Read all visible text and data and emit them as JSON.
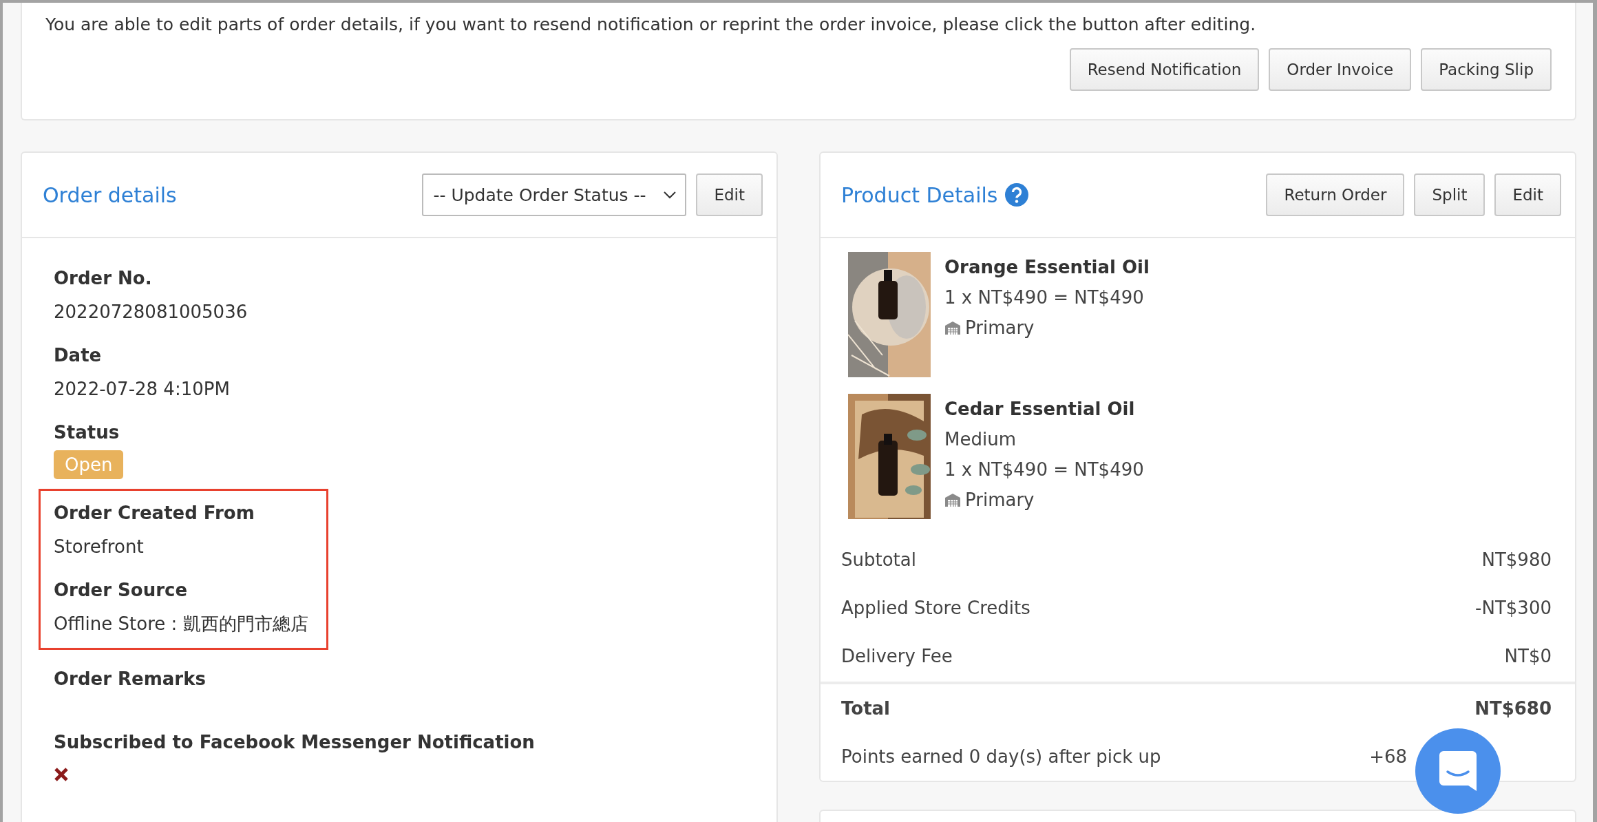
{
  "notice": {
    "text": "You are able to edit parts of order details, if you want to resend notification or reprint the order invoice, please click the button after editing.",
    "buttons": [
      "Resend Notification",
      "Order Invoice",
      "Packing Slip"
    ]
  },
  "order_details": {
    "title": "Order details",
    "status_select": {
      "placeholder": "-- Update Order Status --"
    },
    "edit_button": "Edit",
    "fields": [
      {
        "kind": "text",
        "label": "Order No.",
        "value": "20220728081005036",
        "highlighted": false
      },
      {
        "kind": "text",
        "label": "Date",
        "value": "2022-07-28 4:10PM",
        "highlighted": false
      },
      {
        "kind": "badge",
        "label": "Status",
        "value": "Open",
        "highlighted": false
      },
      {
        "kind": "text",
        "label": "Order Created From",
        "value": "Storefront",
        "highlighted": true
      },
      {
        "kind": "text",
        "label": "Order Source",
        "value": "Offline Store : 凱西的門市總店",
        "highlighted": true
      },
      {
        "kind": "empty",
        "label": "Order Remarks",
        "highlighted": false
      },
      {
        "kind": "check",
        "label": "Subscribed to Facebook Messenger Notification",
        "checked": false,
        "highlighted": false
      }
    ]
  },
  "product_details": {
    "title": "Product Details",
    "buttons": [
      "Return Order",
      "Split",
      "Edit"
    ],
    "products": [
      {
        "name": "Orange Essential Oil",
        "price_line": "1 x NT$490 = NT$490",
        "location": "Primary",
        "kind": "picture"
      },
      {
        "name": "Cedar Essential Oil",
        "variant": "Medium",
        "price_line": "1 x NT$490 = NT$490",
        "location": "Primary",
        "kind": "picture"
      }
    ],
    "summary": [
      {
        "label": "Subtotal",
        "value": "NT$980"
      },
      {
        "label": "Applied Store Credits",
        "value": "-NT$300"
      },
      {
        "label": "Delivery Fee",
        "value": "NT$0"
      }
    ],
    "total": {
      "label": "Total",
      "value": "NT$680"
    },
    "points": {
      "label": "Points earned 0 day(s) after pick up",
      "value": "+68"
    }
  }
}
